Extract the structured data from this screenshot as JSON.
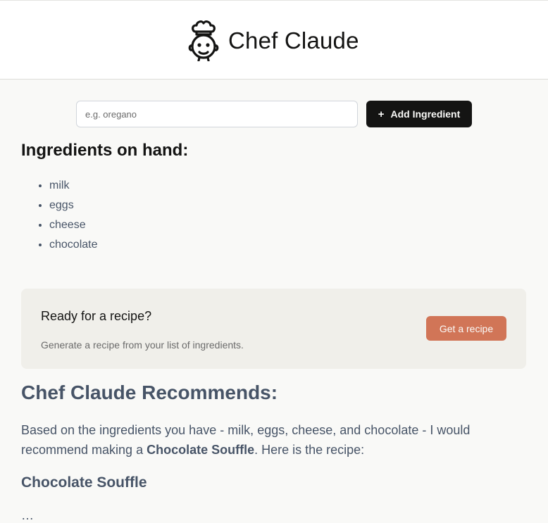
{
  "header": {
    "title": "Chef Claude",
    "logo_icon": "chef-face-icon"
  },
  "form": {
    "input_placeholder": "e.g. oregano",
    "input_value": "",
    "add_button_icon": "+",
    "add_button_label": "Add Ingredient"
  },
  "ingredients": {
    "heading": "Ingredients on hand:",
    "items": [
      "milk",
      "eggs",
      "cheese",
      "chocolate"
    ]
  },
  "cta": {
    "title": "Ready for a recipe?",
    "description": "Generate a recipe from your list of ingredients.",
    "button_label": "Get a recipe"
  },
  "recommendation": {
    "heading": "Chef Claude Recommends:",
    "intro_before": "Based on the ingredients you have - milk, eggs, cheese, and chocolate - I would recommend making a ",
    "dish_name": "Chocolate Souffle",
    "intro_after": ". Here is the recipe:",
    "recipe_title": "Chocolate Souffle",
    "next_line": "…"
  },
  "colors": {
    "accent": "#d17557",
    "dark_button": "#141413",
    "panel": "#f0efea",
    "text_slate": "#475467"
  }
}
